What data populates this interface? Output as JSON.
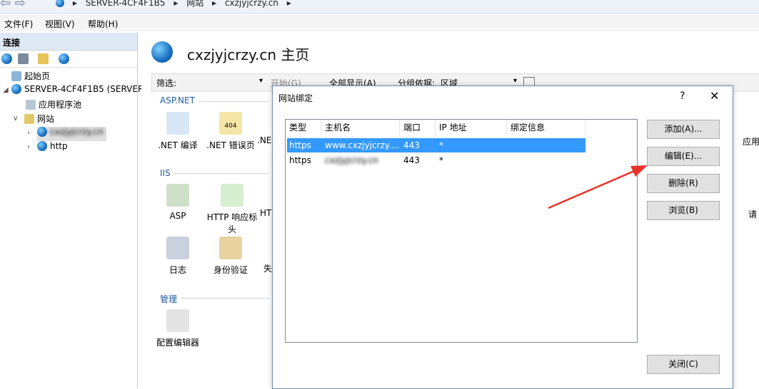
{
  "breadcrumb": [
    "SERVER-4CF4F1B5",
    "网站",
    "cxzjyjcrzy.cn"
  ],
  "menu": [
    "文件(F)",
    "视图(V)",
    "帮助(H)"
  ],
  "connections": {
    "header": "连接",
    "tree": {
      "start_page": "起始页",
      "server": "SERVER-4CF4F1B5 (SERVER",
      "app_pools": "应用程序池",
      "sites": "网站",
      "site1": "cxzjyjcrzy.cn",
      "site2": "http"
    }
  },
  "main": {
    "title": "cxzjyjcrzy.cn 主页",
    "filter_label": "筛选:",
    "start_btn": "开始(G)",
    "show_all": "全部显示(A)",
    "group_label": "分组依据:",
    "group_value": "区域",
    "sections": {
      "aspnet": "ASP.NET",
      "iis": "IIS",
      "manage": "管理"
    },
    "features": {
      "net_compile": ".NET 编译",
      "net_error": ".NET 错误页",
      "net_cut": ".NE",
      "asp": "ASP",
      "http_resp": "HTTP 响应标头",
      "ht_cut": "HT",
      "log": "日志",
      "auth": "身份验证",
      "fail_cut": "失",
      "config": "配置编辑器",
      "app_cut": "应用",
      "req_cut": "请"
    }
  },
  "dialog": {
    "title": "网站绑定",
    "help": "?",
    "close": "✕",
    "columns": [
      "类型",
      "主机名",
      "端口",
      "IP 地址",
      "绑定信息"
    ],
    "rows": [
      {
        "type": "https",
        "host": "www.cxzjyjcrzy....",
        "port": "443",
        "ip": "*",
        "info": ""
      },
      {
        "type": "https",
        "host": "cxzjyjcrzy.cn",
        "port": "443",
        "ip": "*",
        "info": ""
      }
    ],
    "buttons": {
      "add": "添加(A)...",
      "edit": "编辑(E)...",
      "remove": "删除(R)",
      "browse": "浏览(B)",
      "close": "关闭(C)"
    }
  },
  "colors": {
    "selection": "#3399ff",
    "arrow": "#e8332a",
    "section": "#1f5a9d"
  }
}
